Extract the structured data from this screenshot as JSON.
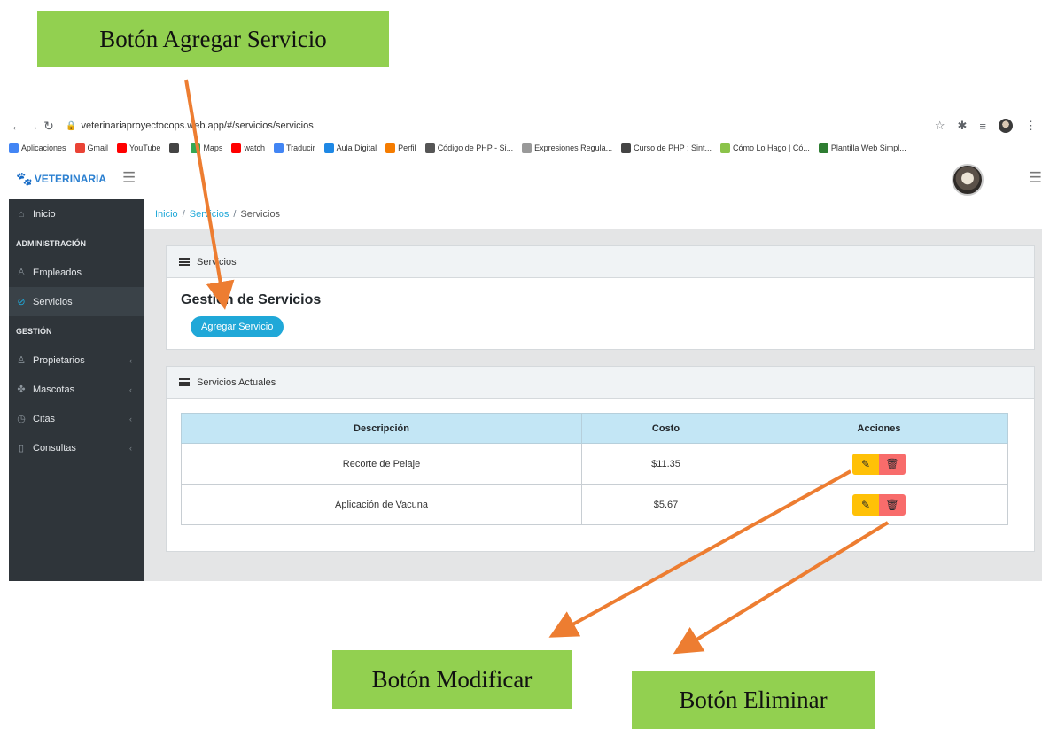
{
  "callouts": {
    "add": "Botón Agregar Servicio",
    "edit": "Botón Modificar",
    "delete": "Botón Eliminar"
  },
  "browser": {
    "url": "veterinariaproyectocops.web.app/#/servicios/servicios",
    "bookmarks": [
      {
        "label": "Aplicaciones",
        "color": "#4285f4"
      },
      {
        "label": "Gmail",
        "color": "#ea4335"
      },
      {
        "label": "YouTube",
        "color": "#ff0000"
      },
      {
        "label": "",
        "color": "#444444"
      },
      {
        "label": "Maps",
        "color": "#34a853"
      },
      {
        "label": "watch",
        "color": "#ff0000"
      },
      {
        "label": "Traducir",
        "color": "#4285f4"
      },
      {
        "label": "Aula Digital",
        "color": "#1e88e5"
      },
      {
        "label": "Perfil",
        "color": "#f57c00"
      },
      {
        "label": "Código de PHP - Si...",
        "color": "#555555"
      },
      {
        "label": "Expresiones Regula...",
        "color": "#999999"
      },
      {
        "label": "Curso de PHP : Sint...",
        "color": "#444444"
      },
      {
        "label": "Cómo Lo Hago | Có...",
        "color": "#8bc34a"
      },
      {
        "label": "Plantilla Web Simpl...",
        "color": "#2e7d32"
      }
    ]
  },
  "app": {
    "brand": "VETERINARIA"
  },
  "sidebar": {
    "inicio": "Inicio",
    "section_admin": "ADMINISTRACIÓN",
    "empleados": "Empleados",
    "servicios": "Servicios",
    "section_gestion": "GESTIÓN",
    "propietarios": "Propietarios",
    "mascotas": "Mascotas",
    "citas": "Citas",
    "consultas": "Consultas"
  },
  "breadcrumb": {
    "home": "Inicio",
    "parent": "Servicios",
    "current": "Servicios"
  },
  "card_servicios": {
    "header": "Servicios",
    "title": "Gestion de Servicios",
    "add_button": "Agregar Servicio"
  },
  "card_actuales": {
    "header": "Servicios Actuales",
    "columns": [
      "Descripción",
      "Costo",
      "Acciones"
    ],
    "rows": [
      {
        "descripcion": "Recorte de Pelaje",
        "costo": "$11.35"
      },
      {
        "descripcion": "Aplicación de Vacuna",
        "costo": "$5.67"
      }
    ]
  },
  "colors": {
    "accent": "#20a8d8",
    "sidebar_bg": "#2f353a",
    "edit_button": "#ffc107",
    "delete_button": "#f86c6b",
    "callout_bg": "#92d050",
    "arrow": "#ed7d31"
  }
}
